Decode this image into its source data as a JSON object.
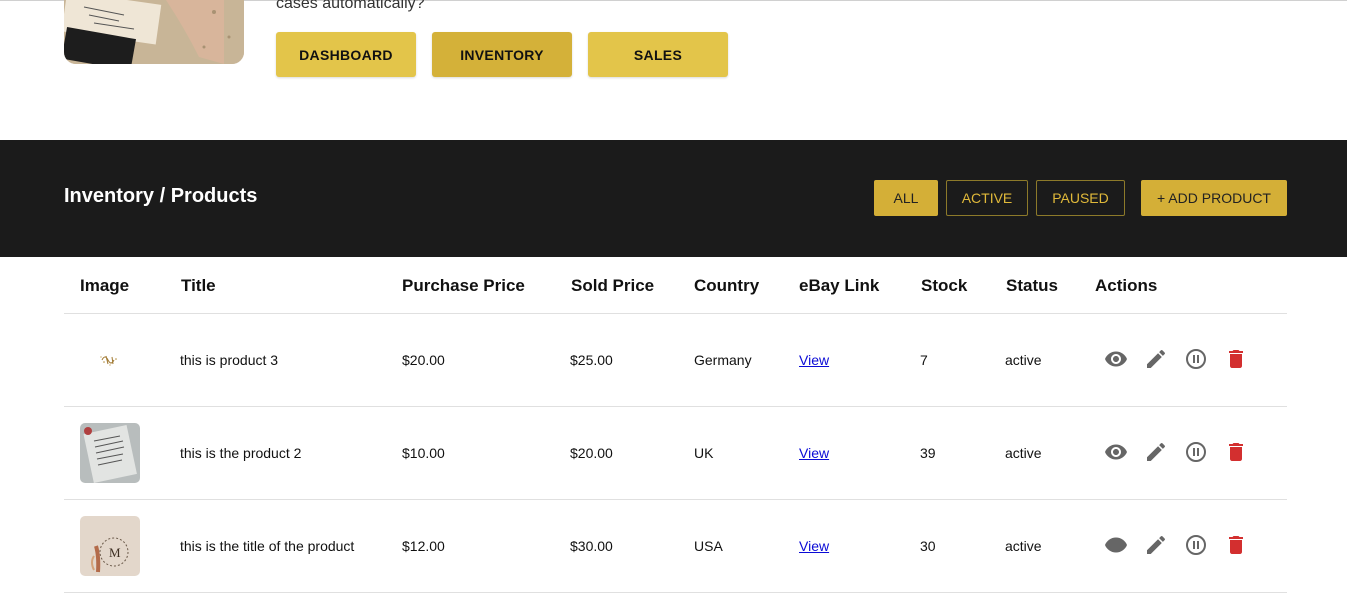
{
  "hero": {
    "text": "cases automatically?"
  },
  "nav": {
    "dashboard": "DASHBOARD",
    "inventory": "INVENTORY",
    "sales": "SALES"
  },
  "header": {
    "title": "Inventory / Products",
    "filters": {
      "all": "ALL",
      "active": "ACTIVE",
      "paused": "PAUSED"
    },
    "add_product": "+ ADD PRODUCT"
  },
  "table": {
    "columns": [
      "Image",
      "Title",
      "Purchase Price",
      "Sold Price",
      "Country",
      "eBay Link",
      "Stock",
      "Status",
      "Actions"
    ],
    "rows": [
      {
        "title": "this is product 3",
        "purchase_price": "$20.00",
        "sold_price": "$25.00",
        "country": "Germany",
        "link": "View",
        "stock": "7",
        "status": "active"
      },
      {
        "title": "this is the product 2",
        "purchase_price": "$10.00",
        "sold_price": "$20.00",
        "country": "UK",
        "link": "View",
        "stock": "39",
        "status": "active"
      },
      {
        "title": "this is the title of the product",
        "purchase_price": "$12.00",
        "sold_price": "$30.00",
        "country": "USA",
        "link": "View",
        "stock": "30",
        "status": "active"
      }
    ]
  },
  "colors": {
    "gold": "#e3c54a",
    "gold_active": "#d4b139",
    "dark_bar": "#1b1b1b",
    "delete": "#d32f2f",
    "icon_gray": "#666666"
  },
  "icons": [
    "view-icon",
    "edit-icon",
    "pause-icon",
    "delete-icon"
  ]
}
